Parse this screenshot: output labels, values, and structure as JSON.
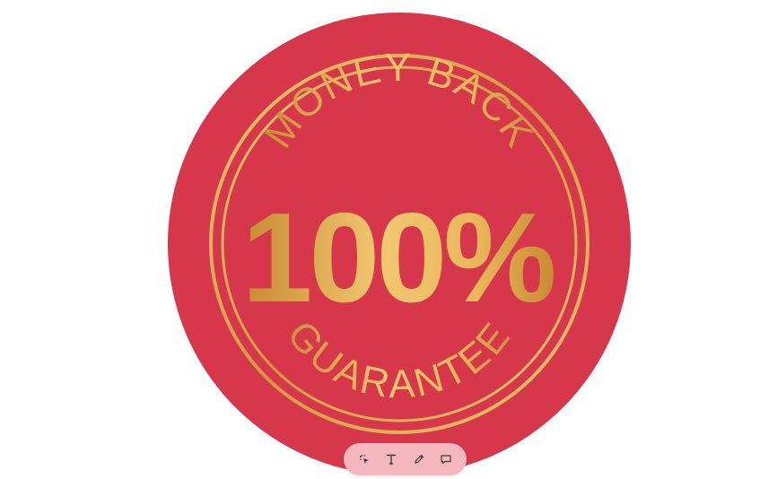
{
  "badge": {
    "top_text": "MONEY BACK",
    "center_text": "100%",
    "bottom_text": "GUARANTEE",
    "colors": {
      "circle": "#d6374b",
      "gold_light": "#f0c870",
      "gold_dark": "#c98a33"
    }
  },
  "toolbar": {
    "background": "#f5b7be",
    "tools": [
      {
        "id": "select",
        "icon": "lasso-select-icon"
      },
      {
        "id": "text",
        "icon": "text-icon"
      },
      {
        "id": "draw",
        "icon": "pencil-icon"
      },
      {
        "id": "comment",
        "icon": "comment-icon"
      }
    ]
  }
}
